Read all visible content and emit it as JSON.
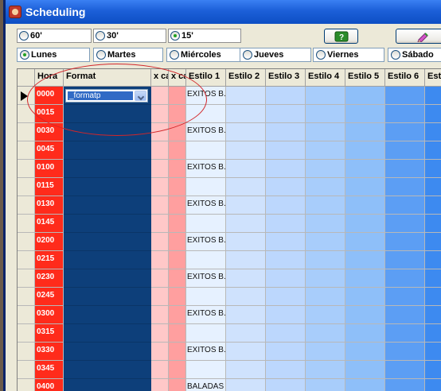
{
  "window": {
    "title": "Scheduling"
  },
  "intervals": [
    {
      "label": "60'",
      "selected": false
    },
    {
      "label": "30'",
      "selected": false
    },
    {
      "label": "15'",
      "selected": true
    }
  ],
  "toolbar": {
    "help_icon": "question-icon",
    "edit_icon": "pencil-icon"
  },
  "days": [
    {
      "label": "Lunes",
      "selected": true
    },
    {
      "label": "Martes",
      "selected": false
    },
    {
      "label": "Miércoles",
      "selected": false
    },
    {
      "label": "Jueves",
      "selected": false
    },
    {
      "label": "Viernes",
      "selected": false
    },
    {
      "label": "Sábado",
      "selected": false
    }
  ],
  "grid": {
    "columns": [
      "Hora",
      "Format",
      "x ca",
      "x ca",
      "Estilo 1",
      "Estilo 2",
      "Estilo 3",
      "Estilo 4",
      "Estilo 5",
      "Estilo 6",
      "Estil"
    ],
    "rows": [
      {
        "hora": "0000",
        "format": "_formatp",
        "estilo1": "EXITOS B..."
      },
      {
        "hora": "0015",
        "format": "",
        "estilo1": ""
      },
      {
        "hora": "0030",
        "format": "",
        "estilo1": "EXITOS B..."
      },
      {
        "hora": "0045",
        "format": "",
        "estilo1": ""
      },
      {
        "hora": "0100",
        "format": "",
        "estilo1": "EXITOS B..."
      },
      {
        "hora": "0115",
        "format": "",
        "estilo1": ""
      },
      {
        "hora": "0130",
        "format": "",
        "estilo1": "EXITOS B..."
      },
      {
        "hora": "0145",
        "format": "",
        "estilo1": ""
      },
      {
        "hora": "0200",
        "format": "",
        "estilo1": "EXITOS B..."
      },
      {
        "hora": "0215",
        "format": "",
        "estilo1": ""
      },
      {
        "hora": "0230",
        "format": "",
        "estilo1": "EXITOS B..."
      },
      {
        "hora": "0245",
        "format": "",
        "estilo1": ""
      },
      {
        "hora": "0300",
        "format": "",
        "estilo1": "EXITOS B..."
      },
      {
        "hora": "0315",
        "format": "",
        "estilo1": ""
      },
      {
        "hora": "0330",
        "format": "",
        "estilo1": "EXITOS B..."
      },
      {
        "hora": "0345",
        "format": "",
        "estilo1": ""
      },
      {
        "hora": "0400",
        "format": "",
        "estilo1": "BALADAS"
      }
    ]
  },
  "colors": {
    "hour": "#ff2b1b",
    "format": "#0d3f7a",
    "annotation": "#d2262a"
  }
}
